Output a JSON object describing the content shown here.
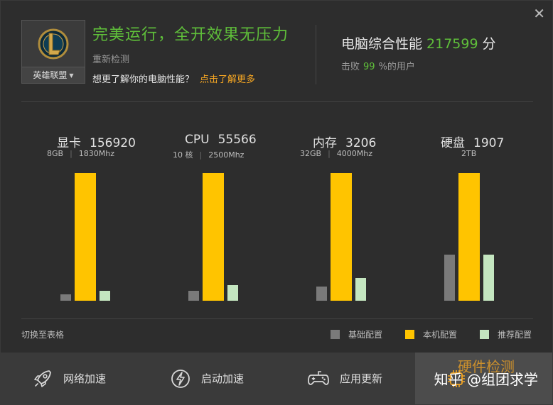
{
  "window": {
    "close_glyph": "✕"
  },
  "game": {
    "name": "英雄联盟",
    "logo_letter": "L",
    "dropdown_icon": "caret-down"
  },
  "status": {
    "headline": "完美运行，全开效果无压力",
    "recheck": "重新检测",
    "question": "想更了解你的电脑性能？",
    "link": "点击了解更多"
  },
  "score": {
    "label": "电脑综合性能",
    "value": "217599",
    "unit": "分",
    "beat_prefix": "击败",
    "beat_value": "99",
    "beat_suffix": "%的用户"
  },
  "components": [
    {
      "name": "显卡",
      "score": "156920",
      "spec1": "8GB",
      "spec2": "1830Mhz"
    },
    {
      "name": "CPU",
      "score": "55566",
      "spec1": "10 核",
      "spec2": "2500Mhz"
    },
    {
      "name": "内存",
      "score": "3206",
      "spec1": "32GB",
      "spec2": "4000Mhz"
    },
    {
      "name": "硬盘",
      "score": "1907",
      "spec1": "2TB",
      "spec2": ""
    }
  ],
  "chart_data": {
    "type": "bar",
    "categories": [
      "显卡",
      "CPU",
      "内存",
      "硬盘"
    ],
    "series": [
      {
        "name": "基础配置",
        "values": [
          0.05,
          0.08,
          0.11,
          0.36
        ]
      },
      {
        "name": "本机配置",
        "values": [
          1.0,
          1.0,
          1.0,
          1.0
        ]
      },
      {
        "name": "推荐配置",
        "values": [
          0.08,
          0.12,
          0.18,
          0.36
        ]
      }
    ],
    "colors": [
      "#7a7a7a",
      "#ffc400",
      "#c4e6c0"
    ]
  },
  "legend": {
    "switch": "切换至表格",
    "items": [
      {
        "label": "基础配置",
        "color": "#7a7a7a"
      },
      {
        "label": "本机配置",
        "color": "#ffc400"
      },
      {
        "label": "推荐配置",
        "color": "#c4e6c0"
      }
    ]
  },
  "tabs": [
    {
      "label": "网络加速",
      "icon": "rocket-icon"
    },
    {
      "label": "启动加速",
      "icon": "lightning-icon"
    },
    {
      "label": "应用更新",
      "icon": "gamepad-icon"
    },
    {
      "label": "",
      "icon": "chip-icon"
    }
  ],
  "watermark": {
    "text": "知乎 @组团求学",
    "obscured": "硬件检测"
  }
}
